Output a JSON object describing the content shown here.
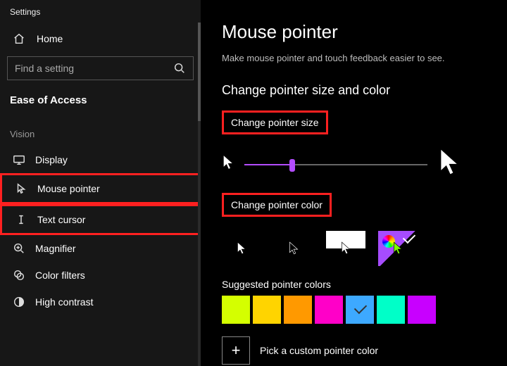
{
  "app_title": "Settings",
  "home_label": "Home",
  "search_placeholder": "Find a setting",
  "section_title": "Ease of Access",
  "group_label": "Vision",
  "nav": {
    "display": "Display",
    "mouse_pointer": "Mouse pointer",
    "text_cursor": "Text cursor",
    "magnifier": "Magnifier",
    "color_filters": "Color filters",
    "high_contrast": "High contrast"
  },
  "page": {
    "title": "Mouse pointer",
    "subtitle": "Make mouse pointer and touch feedback easier to see.",
    "section1": "Change pointer size and color",
    "size_label": "Change pointer size",
    "color_label": "Change pointer color",
    "suggested_label": "Suggested pointer colors",
    "custom_label": "Pick a custom pointer color"
  },
  "slider": {
    "percent": 26
  },
  "suggested_colors": [
    {
      "hex": "#d4ff00",
      "selected": false
    },
    {
      "hex": "#ffd400",
      "selected": false
    },
    {
      "hex": "#ff9900",
      "selected": false
    },
    {
      "hex": "#ff00c8",
      "selected": false
    },
    {
      "hex": "#3da9ff",
      "selected": true
    },
    {
      "hex": "#00ffc8",
      "selected": false
    },
    {
      "hex": "#c800ff",
      "selected": false
    }
  ]
}
